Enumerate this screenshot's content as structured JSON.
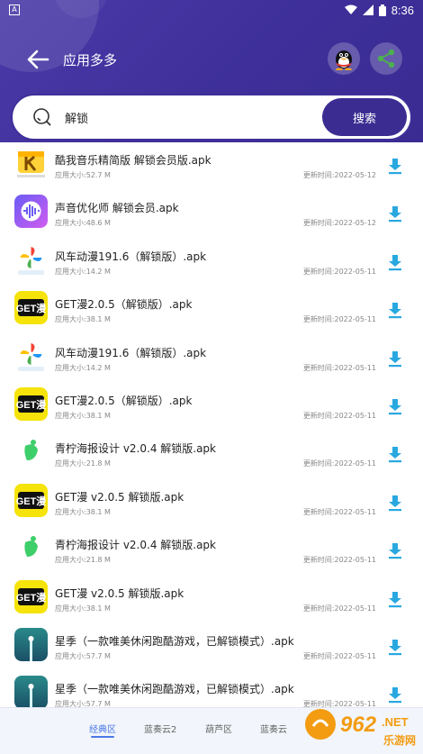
{
  "status_bar": {
    "time": "8:36",
    "indicator": "A"
  },
  "header": {
    "title": "应用多多",
    "back_icon": "arrow-left-icon",
    "qq_icon": "qq-penguin-icon",
    "share_icon": "share-icon"
  },
  "search": {
    "value": "解锁",
    "button_label": "搜索"
  },
  "items": [
    {
      "name": "酷我音乐精简版 解锁会员版.apk",
      "size": "应用大小:52.7 M",
      "date": "更新时间:2022-05-12",
      "icon": "kuwo"
    },
    {
      "name": "声音优化师 解锁会员.apk",
      "size": "应用大小:48.6 M",
      "date": "更新时间:2022-05-12",
      "icon": "voice"
    },
    {
      "name": "风车动漫191.6（解锁版）.apk",
      "size": "应用大小:14.2 M",
      "date": "更新时间:2022-05-11",
      "icon": "pinwheel"
    },
    {
      "name": "GET漫2.0.5（解锁版）.apk",
      "size": "应用大小:38.1 M",
      "date": "更新时间:2022-05-11",
      "icon": "get"
    },
    {
      "name": "风车动漫191.6（解锁版）.apk",
      "size": "应用大小:14.2 M",
      "date": "更新时间:2022-05-11",
      "icon": "pinwheel"
    },
    {
      "name": "GET漫2.0.5（解锁版）.apk",
      "size": "应用大小:38.1 M",
      "date": "更新时间:2022-05-11",
      "icon": "get"
    },
    {
      "name": "青柠海报设计 v2.0.4 解锁版.apk",
      "size": "应用大小:21.8 M",
      "date": "更新时间:2022-05-11",
      "icon": "lime"
    },
    {
      "name": "GET漫 v2.0.5 解锁版.apk",
      "size": "应用大小:38.1 M",
      "date": "更新时间:2022-05-11",
      "icon": "get"
    },
    {
      "name": "青柠海报设计 v2.0.4 解锁版.apk",
      "size": "应用大小:21.8 M",
      "date": "更新时间:2022-05-11",
      "icon": "lime"
    },
    {
      "name": "GET漫 v2.0.5 解锁版.apk",
      "size": "应用大小:38.1 M",
      "date": "更新时间:2022-05-11",
      "icon": "get"
    },
    {
      "name": "星季（一款唯美休闲跑酷游戏，已解锁模式）.apk",
      "size": "应用大小:57.7 M",
      "date": "更新时间:2022-05-11",
      "icon": "star"
    },
    {
      "name": "星季（一款唯美休闲跑酷游戏，已解锁模式）.apk",
      "size": "应用大小:57.7 M",
      "date": "更新时间:2022-05-11",
      "icon": "star"
    }
  ],
  "tabs": [
    {
      "label": "经典区",
      "active": true
    },
    {
      "label": "蓝奏云2",
      "active": false
    },
    {
      "label": "葫芦区",
      "active": false
    },
    {
      "label": "蓝奏云",
      "active": false
    }
  ],
  "watermark": {
    "text_top": "962",
    "text_dot": ".NET",
    "text_bottom": "乐游网"
  },
  "colors": {
    "header": "#3e2f9a",
    "accent": "#3b2c92",
    "download": "#29a8e0",
    "tab_active": "#4a79e8"
  }
}
